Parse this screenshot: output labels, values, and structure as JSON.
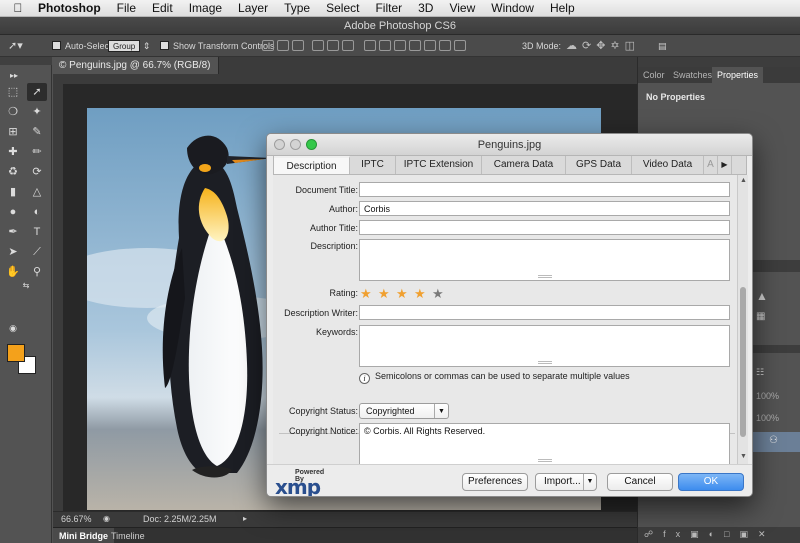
{
  "menubar": {
    "app": "Photoshop",
    "items": [
      "File",
      "Edit",
      "Image",
      "Layer",
      "Type",
      "Select",
      "Filter",
      "3D",
      "View",
      "Window",
      "Help"
    ]
  },
  "window": {
    "title": "Adobe Photoshop CS6"
  },
  "options_bar": {
    "auto_select_label": "Auto-Select:",
    "auto_select_value": "Group",
    "show_transform_label": "Show Transform Controls",
    "mode_3d_label": "3D Mode:"
  },
  "document": {
    "tab_title": "© Penguins.jpg @ 66.7% (RGB/8)",
    "zoom": "66.67%",
    "doc_size": "Doc: 2.25M/2.25M"
  },
  "bottom_tabs": [
    "Mini Bridge",
    "Timeline"
  ],
  "right_panel": {
    "tabs": [
      "Color",
      "Swatches",
      "Properties"
    ],
    "active_tab": "Properties",
    "message": "No Properties",
    "layer_opacity": "100%",
    "layer_fill": "100%"
  },
  "dialog": {
    "title": "Penguins.jpg",
    "tabs": [
      "Description",
      "IPTC",
      "IPTC Extension",
      "Camera Data",
      "GPS Data",
      "Video Data",
      "A"
    ],
    "active_tab": "Description",
    "fields": {
      "document_title": {
        "label": "Document Title:",
        "value": ""
      },
      "author": {
        "label": "Author:",
        "value": "Corbis"
      },
      "author_title": {
        "label": "Author Title:",
        "value": ""
      },
      "description": {
        "label": "Description:",
        "value": ""
      },
      "rating": {
        "label": "Rating:",
        "value": 4,
        "max": 5
      },
      "description_writer": {
        "label": "Description Writer:",
        "value": ""
      },
      "keywords": {
        "label": "Keywords:",
        "value": ""
      },
      "keywords_hint": "Semicolons or commas can be used to separate multiple values",
      "copyright_status": {
        "label": "Copyright Status:",
        "value": "Copyrighted"
      },
      "copyright_notice": {
        "label": "Copyright Notice:",
        "value": "© Corbis.  All Rights Reserved."
      }
    },
    "logo": {
      "powered_by": "Powered By",
      "name": "xmp"
    },
    "buttons": {
      "preferences": "Preferences",
      "import": "Import...",
      "cancel": "Cancel",
      "ok": "OK"
    }
  },
  "colors": {
    "foreground": "#f4a11b",
    "background": "#ffffff",
    "star_on": "#f0a030",
    "star_off": "#7a7a7a",
    "ok_button": "#3d8cee"
  }
}
